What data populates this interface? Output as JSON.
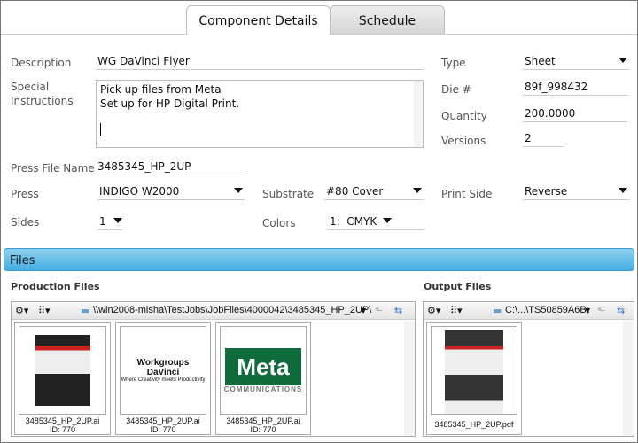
{
  "tabs": [
    {
      "label": "Component Details",
      "active": true
    },
    {
      "label": "Schedule",
      "active": false
    }
  ],
  "form": {
    "description_label": "Description",
    "description": "WG DaVinci Flyer",
    "special_label_1": "Special",
    "special_label_2": "Instructions",
    "instructions_line1": "Pick up files from Meta",
    "instructions_line2": "Set up for HP Digital Print.",
    "type_label": "Type",
    "type": "Sheet",
    "die_label": "Die #",
    "die": "89f_998432",
    "quantity_label": "Quantity",
    "quantity": "200.0000",
    "versions_label": "Versions",
    "versions": "2",
    "press_file_label": "Press File Name",
    "press_file": "3485345_HP_2UP",
    "press_label": "Press",
    "press": "INDIGO W2000",
    "substrate_label": "Substrate",
    "substrate": "#80 Cover",
    "print_side_label": "Print Side",
    "print_side": "Reverse",
    "sides_label": "Sides",
    "sides": "1",
    "colors_label": "Colors",
    "colors": "1:  CMYK"
  },
  "files": {
    "header": "Files",
    "production": {
      "title": "Production Files",
      "path": "\\\\win2008-misha\\TestJobs\\JobFiles\\4000042\\3485345_HP_2UP\\",
      "items": [
        {
          "name": "3485345_HP_2UP.ai",
          "id": "ID: 770"
        },
        {
          "name": "3485345_HP_2UP.ai",
          "id": "ID: 770",
          "logo": "Workgroups DaVinci",
          "tagline": "Where Creativity meets Productivity"
        },
        {
          "name": "3485345_HP_2UP.ai",
          "id": "ID: 770",
          "logo": "Meta",
          "tagline": "COMMUNICATIONS"
        }
      ]
    },
    "output": {
      "title": "Output Files",
      "path": "C:\\...\\TS50859A6B\\",
      "items": [
        {
          "name": "3485345_HP_2UP.pdf"
        }
      ]
    }
  },
  "colors": {
    "accent": "#44ade0",
    "meta_green": "#0f6b3c"
  }
}
